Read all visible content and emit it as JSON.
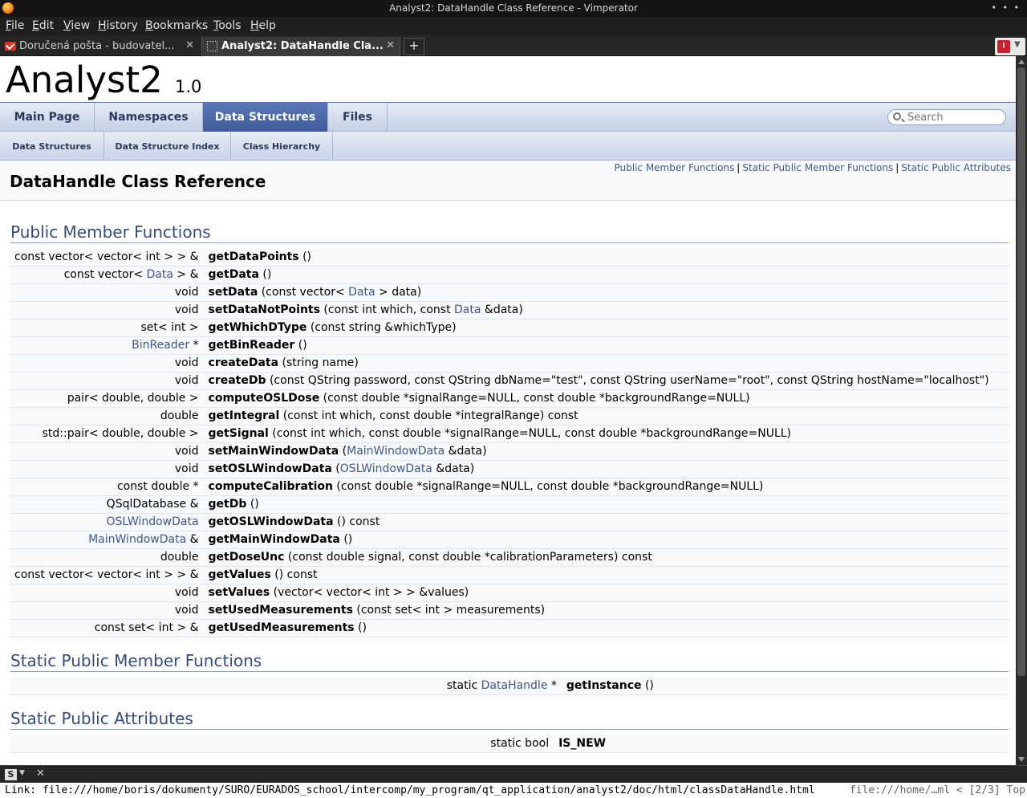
{
  "window": {
    "title": "Analyst2: DataHandle Class Reference - Vimperator",
    "controls": "• • •"
  },
  "menubar": [
    "File",
    "Edit",
    "View",
    "History",
    "Bookmarks",
    "Tools",
    "Help"
  ],
  "tabs": [
    {
      "label": "Doručená pošta - budovatel...",
      "icon": "gmail-icon",
      "active": false
    },
    {
      "label": "Analyst2: DataHandle Cla...",
      "icon": "page-icon",
      "active": true
    }
  ],
  "newtab_label": "+",
  "close_glyph": "✕",
  "project": {
    "name": "Analyst2",
    "number": "1.0"
  },
  "nav_main": [
    {
      "label": "Main Page",
      "active": false
    },
    {
      "label": "Namespaces",
      "active": false
    },
    {
      "label": "Data Structures",
      "active": true
    },
    {
      "label": "Files",
      "active": false
    }
  ],
  "search": {
    "placeholder": "Search"
  },
  "nav_sub": [
    "Data Structures",
    "Data Structure Index",
    "Class Hierarchy"
  ],
  "summary_links": [
    "Public Member Functions",
    "Static Public Member Functions",
    "Static Public Attributes"
  ],
  "summary_sep": "|",
  "class_title": "DataHandle Class Reference",
  "sections": {
    "public_member_functions": "Public Member Functions",
    "static_public_member_functions": "Static Public Member Functions",
    "static_public_attributes": "Static Public Attributes"
  },
  "public_members": [
    {
      "type": [
        {
          "t": "const vector< vector< int > > &"
        }
      ],
      "name": "getDataPoints",
      "args": [
        {
          "t": " ()"
        }
      ]
    },
    {
      "type": [
        {
          "t": "const vector< "
        },
        {
          "t": "Data",
          "link": true
        },
        {
          "t": " > &"
        }
      ],
      "name": "getData",
      "args": [
        {
          "t": " ()"
        }
      ]
    },
    {
      "type": [
        {
          "t": "void"
        }
      ],
      "name": "setData",
      "args": [
        {
          "t": " (const vector< "
        },
        {
          "t": "Data",
          "link": true
        },
        {
          "t": " > data)"
        }
      ]
    },
    {
      "type": [
        {
          "t": "void"
        }
      ],
      "name": "setDataNotPoints",
      "args": [
        {
          "t": " (const int which, const "
        },
        {
          "t": "Data",
          "link": true
        },
        {
          "t": " &data)"
        }
      ]
    },
    {
      "type": [
        {
          "t": "set< int >"
        }
      ],
      "name": "getWhichDType",
      "args": [
        {
          "t": " (const string &whichType)"
        }
      ]
    },
    {
      "type": [
        {
          "t": "BinReader",
          "link": true
        },
        {
          "t": " *"
        }
      ],
      "name": "getBinReader",
      "args": [
        {
          "t": " ()"
        }
      ]
    },
    {
      "type": [
        {
          "t": "void"
        }
      ],
      "name": "createData",
      "args": [
        {
          "t": " (string name)"
        }
      ]
    },
    {
      "type": [
        {
          "t": "void"
        }
      ],
      "name": "createDb",
      "args": [
        {
          "t": " (const QString password, const QString dbName=\"test\", const QString userName=\"root\", const QString hostName=\"localhost\")"
        }
      ]
    },
    {
      "type": [
        {
          "t": "pair< double, double >"
        }
      ],
      "name": "computeOSLDose",
      "args": [
        {
          "t": " (const double *signalRange=NULL, const double *backgroundRange=NULL)"
        }
      ]
    },
    {
      "type": [
        {
          "t": "double"
        }
      ],
      "name": "getIntegral",
      "args": [
        {
          "t": " (const int which, const double *integralRange) const"
        }
      ]
    },
    {
      "type": [
        {
          "t": "std::pair< double, double >"
        }
      ],
      "name": "getSignal",
      "args": [
        {
          "t": " (const int which, const double *signalRange=NULL, const double *backgroundRange=NULL)"
        }
      ]
    },
    {
      "type": [
        {
          "t": "void"
        }
      ],
      "name": "setMainWindowData",
      "args": [
        {
          "t": " ("
        },
        {
          "t": "MainWindowData",
          "link": true
        },
        {
          "t": " &data)"
        }
      ]
    },
    {
      "type": [
        {
          "t": "void"
        }
      ],
      "name": "setOSLWindowData",
      "args": [
        {
          "t": " ("
        },
        {
          "t": "OSLWindowData",
          "link": true
        },
        {
          "t": " &data)"
        }
      ]
    },
    {
      "type": [
        {
          "t": "const double *"
        }
      ],
      "name": "computeCalibration",
      "args": [
        {
          "t": " (const double *signalRange=NULL, const double *backgroundRange=NULL)"
        }
      ]
    },
    {
      "type": [
        {
          "t": "QSqlDatabase &"
        }
      ],
      "name": "getDb",
      "args": [
        {
          "t": " ()"
        }
      ]
    },
    {
      "type": [
        {
          "t": "OSLWindowData",
          "link": true
        }
      ],
      "name": "getOSLWindowData",
      "args": [
        {
          "t": " () const"
        }
      ]
    },
    {
      "type": [
        {
          "t": "MainWindowData",
          "link": true
        },
        {
          "t": " &"
        }
      ],
      "name": "getMainWindowData",
      "args": [
        {
          "t": " ()"
        }
      ]
    },
    {
      "type": [
        {
          "t": "double"
        }
      ],
      "name": "getDoseUnc",
      "args": [
        {
          "t": " (const double signal, const double *calibrationParameters) const"
        }
      ]
    },
    {
      "type": [
        {
          "t": "const vector< vector< int > > &"
        }
      ],
      "name": "getValues",
      "args": [
        {
          "t": " () const"
        }
      ]
    },
    {
      "type": [
        {
          "t": "void"
        }
      ],
      "name": "setValues",
      "args": [
        {
          "t": " (vector< vector< int > > &values)"
        }
      ]
    },
    {
      "type": [
        {
          "t": "void"
        }
      ],
      "name": "setUsedMeasurements",
      "args": [
        {
          "t": " (const set< int > measurements)"
        }
      ]
    },
    {
      "type": [
        {
          "t": "const set< int > &"
        }
      ],
      "name": "getUsedMeasurements",
      "args": [
        {
          "t": " ()"
        }
      ]
    }
  ],
  "static_members": [
    {
      "type": [
        {
          "t": "static "
        },
        {
          "t": "DataHandle",
          "link": true
        },
        {
          "t": " *"
        }
      ],
      "name": "getInstance",
      "args": [
        {
          "t": " ()"
        }
      ]
    }
  ],
  "static_attributes": [
    {
      "type": [
        {
          "t": "static bool"
        }
      ],
      "name": "IS_NEW",
      "args": []
    }
  ],
  "statusbar": {
    "badge": "S"
  },
  "cmdline": {
    "link": "Link: file:///home/boris/dokumenty/SURO/EURADOS_school/intercomp/my_program/qt_application/analyst2/doc/html/classDataHandle.html",
    "url_info": "file:///home/…ml < [2/3] Top"
  }
}
